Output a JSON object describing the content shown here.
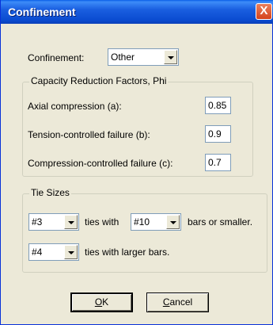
{
  "window": {
    "title": "Confinement",
    "close_glyph": "X"
  },
  "confinement": {
    "label": "Confinement:",
    "selected": "Other"
  },
  "phi_group": {
    "title": "Capacity Reduction Factors, Phi",
    "rows": [
      {
        "label": "Axial compression (a):",
        "value": "0.85"
      },
      {
        "label": "Tension-controlled failure (b):",
        "value": "0.9"
      },
      {
        "label": "Compression-controlled failure (c):",
        "value": "0.7"
      }
    ]
  },
  "tie_group": {
    "title": "Tie Sizes",
    "row1": {
      "tie_selected": "#3",
      "middle_text": "ties with",
      "bar_selected": "#10",
      "suffix_text": "bars or smaller."
    },
    "row2": {
      "tie_selected": "#4",
      "suffix_text": "ties with larger bars."
    }
  },
  "buttons": {
    "ok": {
      "mnemonic": "O",
      "rest": "K"
    },
    "cancel": {
      "mnemonic": "C",
      "rest": "ancel"
    }
  }
}
